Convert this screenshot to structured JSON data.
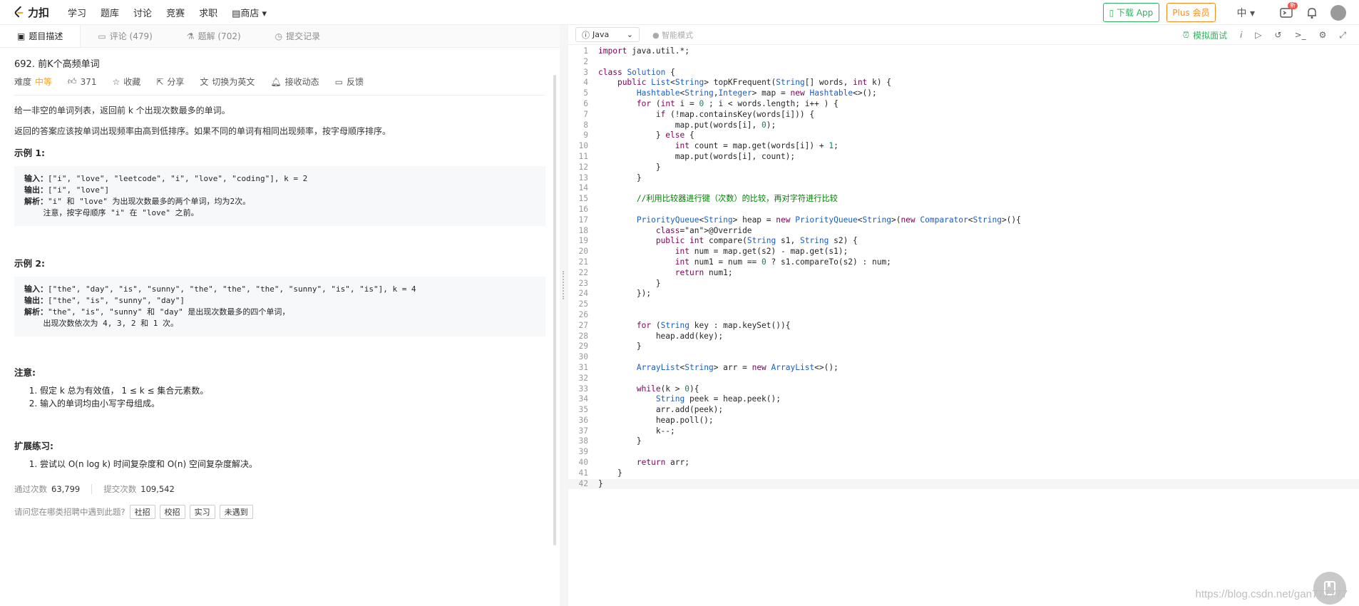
{
  "nav": {
    "logo": "力扣",
    "links": [
      "学习",
      "题库",
      "讨论",
      "竞赛",
      "求职"
    ],
    "store": "商店 ▾",
    "download": "下载 App",
    "plus": "Plus 会员",
    "lang": "中 ▾",
    "badge": "新"
  },
  "tabs": [
    "题目描述",
    "评论 (479)",
    "题解 (702)",
    "提交记录"
  ],
  "problem": {
    "title": "692. 前K个高频单词",
    "difficulty_label": "难度",
    "difficulty": "中等",
    "likes": "371",
    "actions": [
      "收藏",
      "分享",
      "切换为英文",
      "接收动态",
      "反馈"
    ],
    "desc1": "给一非空的单词列表，返回前 k 个出现次数最多的单词。",
    "desc2": "返回的答案应该按单词出现频率由高到低排序。如果不同的单词有相同出现频率，按字母顺序排序。",
    "ex1_title": "示例 1:",
    "ex1": {
      "in_label": "输入：",
      "in": "[\"i\", \"love\", \"leetcode\", \"i\", \"love\", \"coding\"], k = 2",
      "out_label": "输出：",
      "out": "[\"i\", \"love\"]",
      "exp_label": "解析：",
      "exp1": "\"i\" 和 \"love\" 为出现次数最多的两个单词，均为2次。",
      "exp2": "    注意，按字母顺序 \"i\" 在 \"love\" 之前。"
    },
    "ex2_title": "示例 2:",
    "ex2": {
      "in_label": "输入：",
      "in": "[\"the\", \"day\", \"is\", \"sunny\", \"the\", \"the\", \"the\", \"sunny\", \"is\", \"is\"], k = 4",
      "out_label": "输出：",
      "out": "[\"the\", \"is\", \"sunny\", \"day\"]",
      "exp_label": "解析：",
      "exp1": "\"the\", \"is\", \"sunny\" 和 \"day\" 是出现次数最多的四个单词，",
      "exp2": "    出现次数依次为 4, 3, 2 和 1 次。"
    },
    "note_title": "注意:",
    "notes": [
      "假定 k 总为有效值， 1 ≤ k ≤ 集合元素数。",
      "输入的单词均由小写字母组成。"
    ],
    "ext_title": "扩展练习:",
    "ext": [
      "尝试以 O(n log k) 时间复杂度和 O(n) 空间复杂度解决。"
    ],
    "pass_label": "通过次数",
    "pass": "63,799",
    "submit_label": "提交次数",
    "submit": "109,542",
    "ask": "请问您在哪类招聘中遇到此题?",
    "chips": [
      "社招",
      "校招",
      "实习",
      "未遇到"
    ]
  },
  "editor": {
    "language": "Java",
    "smart": "智能模式",
    "interview": "模拟面试",
    "lines": [
      "import java.util.*;",
      "",
      "class Solution {",
      "    public List<String> topKFrequent(String[] words, int k) {",
      "        Hashtable<String,Integer> map = new Hashtable<>();",
      "        for (int i = 0 ; i < words.length; i++ ) {",
      "            if (!map.containsKey(words[i])) {",
      "                map.put(words[i], 0);",
      "            } else {",
      "                int count = map.get(words[i]) + 1;",
      "                map.put(words[i], count);",
      "            }",
      "        }",
      "",
      "        //利用比较器进行键（次数）的比较，再对字符进行比较",
      "",
      "        PriorityQueue<String> heap = new PriorityQueue<String>(new Comparator<String>(){",
      "            @Override",
      "            public int compare(String s1, String s2) {",
      "                int num = map.get(s2) - map.get(s1);",
      "                int num1 = num == 0 ? s1.compareTo(s2) : num;",
      "                return num1;",
      "            }",
      "        });",
      "",
      "",
      "        for (String key : map.keySet()){",
      "            heap.add(key);",
      "        }",
      "",
      "        ArrayList<String> arr = new ArrayList<>();",
      "",
      "        while(k > 0){",
      "            String peek = heap.peek();",
      "            arr.add(peek);",
      "            heap.poll();",
      "            k--;",
      "        }",
      "",
      "        return arr;",
      "    }",
      "}"
    ]
  },
  "watermark": "https://blog.csdn.net/gan777777"
}
